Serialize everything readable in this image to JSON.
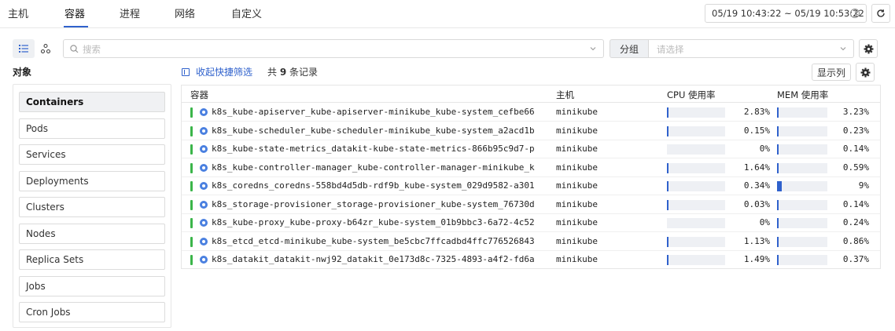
{
  "nav": {
    "tabs": [
      {
        "label": "主机"
      },
      {
        "label": "容器"
      },
      {
        "label": "进程"
      },
      {
        "label": "网络"
      },
      {
        "label": "自定义"
      }
    ],
    "active_tab": "容器",
    "time_range": "05/19 10:43:22 ~ 05/19 10:53:22"
  },
  "toolbar": {
    "search_placeholder": "搜索",
    "group_label": "分组",
    "group_placeholder": "请选择"
  },
  "objects": {
    "title": "对象",
    "items": [
      {
        "label": "Containers"
      },
      {
        "label": "Pods"
      },
      {
        "label": "Services"
      },
      {
        "label": "Deployments"
      },
      {
        "label": "Clusters"
      },
      {
        "label": "Nodes"
      },
      {
        "label": "Replica Sets"
      },
      {
        "label": "Jobs"
      },
      {
        "label": "Cron Jobs"
      }
    ],
    "active": "Containers"
  },
  "list_bar": {
    "collapse_label": "收起快捷筛选",
    "records_prefix": "共",
    "records_count": "9",
    "records_suffix": "条记录",
    "columns_button": "显示列"
  },
  "table": {
    "headers": {
      "container": "容器",
      "host": "主机",
      "cpu": "CPU 使用率",
      "mem": "MEM 使用率"
    },
    "rows": [
      {
        "name": "k8s_kube-apiserver_kube-apiserver-minikube_kube-system_cefbe66",
        "host": "minikube",
        "cpu": "2.83%",
        "cpu_value": 2.83,
        "mem": "3.23%",
        "mem_value": 3.23
      },
      {
        "name": "k8s_kube-scheduler_kube-scheduler-minikube_kube-system_a2acd1b",
        "host": "minikube",
        "cpu": "0.15%",
        "cpu_value": 0.15,
        "mem": "0.23%",
        "mem_value": 0.23
      },
      {
        "name": "k8s_kube-state-metrics_datakit-kube-state-metrics-866b95c9d7-p",
        "host": "minikube",
        "cpu": "0%",
        "cpu_value": 0,
        "mem": "0.14%",
        "mem_value": 0.14
      },
      {
        "name": "k8s_kube-controller-manager_kube-controller-manager-minikube_k",
        "host": "minikube",
        "cpu": "1.64%",
        "cpu_value": 1.64,
        "mem": "0.59%",
        "mem_value": 0.59
      },
      {
        "name": "k8s_coredns_coredns-558bd4d5db-rdf9b_kube-system_029d9582-a301",
        "host": "minikube",
        "cpu": "0.34%",
        "cpu_value": 0.34,
        "mem": "9%",
        "mem_value": 9
      },
      {
        "name": "k8s_storage-provisioner_storage-provisioner_kube-system_76730d",
        "host": "minikube",
        "cpu": "0.03%",
        "cpu_value": 0.03,
        "mem": "0.14%",
        "mem_value": 0.14
      },
      {
        "name": "k8s_kube-proxy_kube-proxy-b64zr_kube-system_01b9bbc3-6a72-4c52",
        "host": "minikube",
        "cpu": "0%",
        "cpu_value": 0,
        "mem": "0.24%",
        "mem_value": 0.24
      },
      {
        "name": "k8s_etcd_etcd-minikube_kube-system_be5cbc7ffcadbd4ffc776526843",
        "host": "minikube",
        "cpu": "1.13%",
        "cpu_value": 1.13,
        "mem": "0.86%",
        "mem_value": 0.86
      },
      {
        "name": "k8s_datakit_datakit-nwj92_datakit_0e173d8c-7325-4893-a4f2-fd6a",
        "host": "minikube",
        "cpu": "1.49%",
        "cpu_value": 1.49,
        "mem": "0.37%",
        "mem_value": 0.37
      }
    ]
  },
  "icons": {
    "refresh": "refresh-icon",
    "clock": "clock-icon",
    "list_view": "list-view-icon",
    "topology_view": "topology-view-icon",
    "search": "search-icon",
    "chevron": "chevron-down-icon",
    "gear": "gear-icon",
    "container": "k8s-icon"
  },
  "colors": {
    "accent": "#2f61cc",
    "status_ok": "#3bb54a",
    "bar_track": "#eef0f4"
  }
}
